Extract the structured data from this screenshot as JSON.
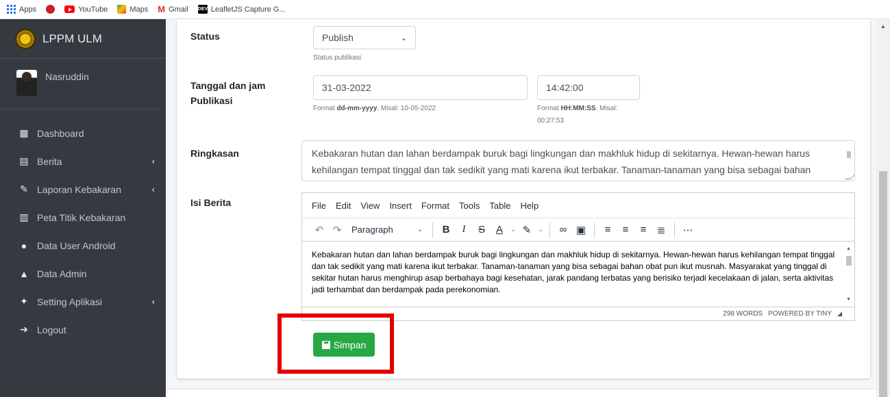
{
  "bookmarks": [
    {
      "label": "Apps",
      "icon": "apps-grid-icon"
    },
    {
      "label": "",
      "icon": "circle-bookmark-icon"
    },
    {
      "label": "YouTube",
      "icon": "youtube-icon"
    },
    {
      "label": "Maps",
      "icon": "maps-icon"
    },
    {
      "label": "Gmail",
      "icon": "gmail-icon"
    },
    {
      "label": "LeafletJS Capture G...",
      "icon": "dev-icon"
    }
  ],
  "sidebar": {
    "brand": "LPPM ULM",
    "user": "Nasruddin",
    "items": [
      {
        "label": "Dashboard",
        "icon": "dashboard-icon",
        "has_caret": false
      },
      {
        "label": "Berita",
        "icon": "newspaper-icon",
        "has_caret": true
      },
      {
        "label": "Laporan Kebakaran",
        "icon": "edit-icon",
        "has_caret": true
      },
      {
        "label": "Peta Titik Kebakaran",
        "icon": "map-icon",
        "has_caret": false
      },
      {
        "label": "Data User Android",
        "icon": "users-icon",
        "has_caret": false
      },
      {
        "label": "Data Admin",
        "icon": "lock-icon",
        "has_caret": false
      },
      {
        "label": "Setting Aplikasi",
        "icon": "wrench-icon",
        "has_caret": true
      },
      {
        "label": "Logout",
        "icon": "sign-out-icon",
        "has_caret": false
      }
    ]
  },
  "form": {
    "status": {
      "label": "Status",
      "value": "Publish",
      "help": "Status publikasi"
    },
    "publish": {
      "label_line1": "Tanggal dan jam",
      "label_line2": "Publikasi",
      "date_value": "31-03-2022",
      "date_help_prefix": "Format ",
      "date_help_format": "dd-mm-yyyy",
      "date_help_suffix": ". Misal: 10-05-2022",
      "time_value": "14:42:00",
      "time_help_prefix": "Format ",
      "time_help_format": "HH:MM:SS",
      "time_help_suffix": ". Misal:",
      "time_help_example": "00:27:53"
    },
    "ringkasan": {
      "label": "Ringkasan",
      "value": "Kebakaran hutan dan lahan berdampak buruk bagi lingkungan dan makhluk hidup di sekitarnya. Hewan-hewan harus kehilangan tempat tinggal dan tak sedikit yang mati karena ikut terbakar. Tanaman-tanaman yang bisa sebagai bahan"
    },
    "isi": {
      "label": "Isi Berita",
      "menu": [
        "File",
        "Edit",
        "View",
        "Insert",
        "Format",
        "Tools",
        "Table",
        "Help"
      ],
      "block_format": "Paragraph",
      "content": "Kebakaran hutan dan lahan berdampak buruk bagi lingkungan dan makhluk hidup di sekitarnya. Hewan-hewan harus kehilangan tempat tinggal dan tak sedikit yang mati karena ikut terbakar. Tanaman-tanaman yang bisa sebagai bahan obat pun ikut musnah. Masyarakat yang tinggal di sekitar hutan harus menghirup asap berbahaya bagi kesehatan, jarak pandang terbatas yang berisiko terjadi kecelakaan di jalan, serta aktivitas jadi terhambat dan berdampak pada perekonomian.",
      "word_count": "298 WORDS",
      "powered_by": "POWERED BY TINY"
    },
    "save_label": "Simpan"
  },
  "colors": {
    "sidebar_bg": "#343a40",
    "success": "#28a745",
    "highlight": "#e10000"
  }
}
